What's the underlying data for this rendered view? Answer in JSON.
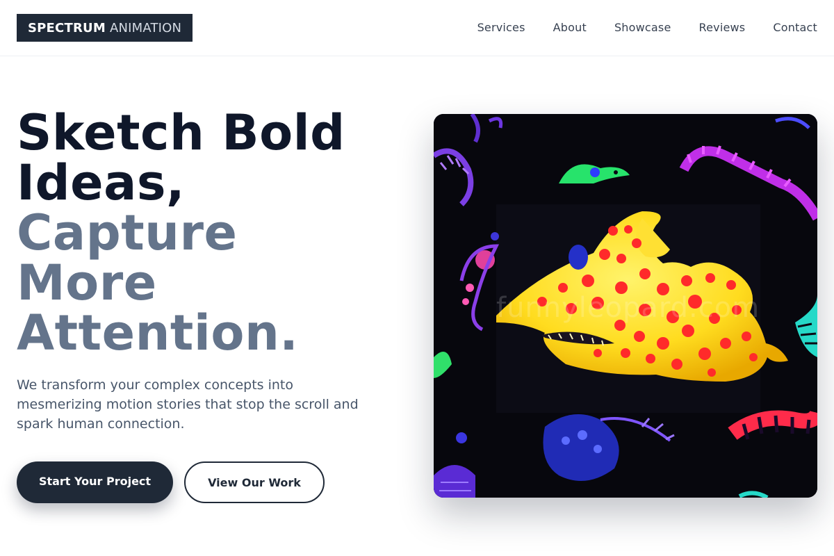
{
  "header": {
    "logo_strong": "SPECTRUM",
    "logo_light": "ANIMATION",
    "nav": [
      "Services",
      "About",
      "Showcase",
      "Reviews",
      "Contact"
    ]
  },
  "hero": {
    "title_dark": [
      "Sketch Bold",
      "Ideas,"
    ],
    "title_muted": [
      "Capture",
      "More",
      "Attention."
    ],
    "subtitle": "We transform your complex concepts into mesmerizing motion stories that stop the scroll and spark human connection.",
    "primary_button": "Start Your Project",
    "secondary_button": "View Our Work",
    "image_watermark": "funnyleopard.com"
  },
  "colors": {
    "brand_dark": "#1f2937",
    "title_muted": "#64748b",
    "image_bg": "#07070d"
  }
}
